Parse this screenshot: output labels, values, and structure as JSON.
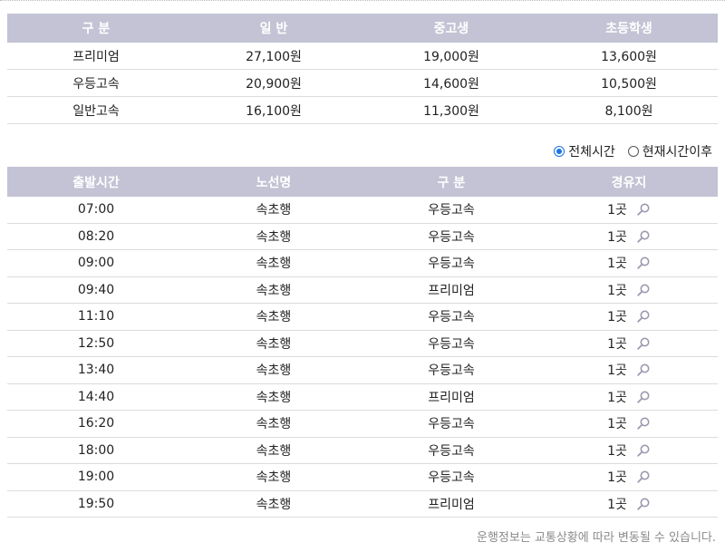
{
  "fare_table": {
    "headers": [
      "구 분",
      "일 반",
      "중고생",
      "초등학생"
    ],
    "rows": [
      [
        "프리미엄",
        "27,100원",
        "19,000원",
        "13,600원"
      ],
      [
        "우등고속",
        "20,900원",
        "14,600원",
        "10,500원"
      ],
      [
        "일반고속",
        "16,100원",
        "11,300원",
        "8,100원"
      ]
    ]
  },
  "time_filter": {
    "options": [
      {
        "label": "전체시간",
        "selected": true
      },
      {
        "label": "현재시간이후",
        "selected": false
      }
    ],
    "accent_color": "#1a73e8"
  },
  "schedule_table": {
    "headers": [
      "출발시간",
      "노선명",
      "구 분",
      "경유지"
    ],
    "rows": [
      {
        "time": "07:00",
        "route": "속초행",
        "class": "우등고속",
        "stops": "1곳"
      },
      {
        "time": "08:20",
        "route": "속초행",
        "class": "우등고속",
        "stops": "1곳"
      },
      {
        "time": "09:00",
        "route": "속초행",
        "class": "우등고속",
        "stops": "1곳"
      },
      {
        "time": "09:40",
        "route": "속초행",
        "class": "프리미엄",
        "stops": "1곳"
      },
      {
        "time": "11:10",
        "route": "속초행",
        "class": "우등고속",
        "stops": "1곳"
      },
      {
        "time": "12:50",
        "route": "속초행",
        "class": "우등고속",
        "stops": "1곳"
      },
      {
        "time": "13:40",
        "route": "속초행",
        "class": "우등고속",
        "stops": "1곳"
      },
      {
        "time": "14:40",
        "route": "속초행",
        "class": "프리미엄",
        "stops": "1곳"
      },
      {
        "time": "16:20",
        "route": "속초행",
        "class": "우등고속",
        "stops": "1곳"
      },
      {
        "time": "18:00",
        "route": "속초행",
        "class": "우등고속",
        "stops": "1곳"
      },
      {
        "time": "19:00",
        "route": "속초행",
        "class": "우등고속",
        "stops": "1곳"
      },
      {
        "time": "19:50",
        "route": "속초행",
        "class": "프리미엄",
        "stops": "1곳"
      }
    ],
    "stop_icon": "magnifier-icon"
  },
  "footnote": "운행정보는 교통상황에 따라 변동될 수 있습니다.",
  "colors": {
    "header_bg": "#c3c3d5",
    "header_text": "#ffffff"
  }
}
